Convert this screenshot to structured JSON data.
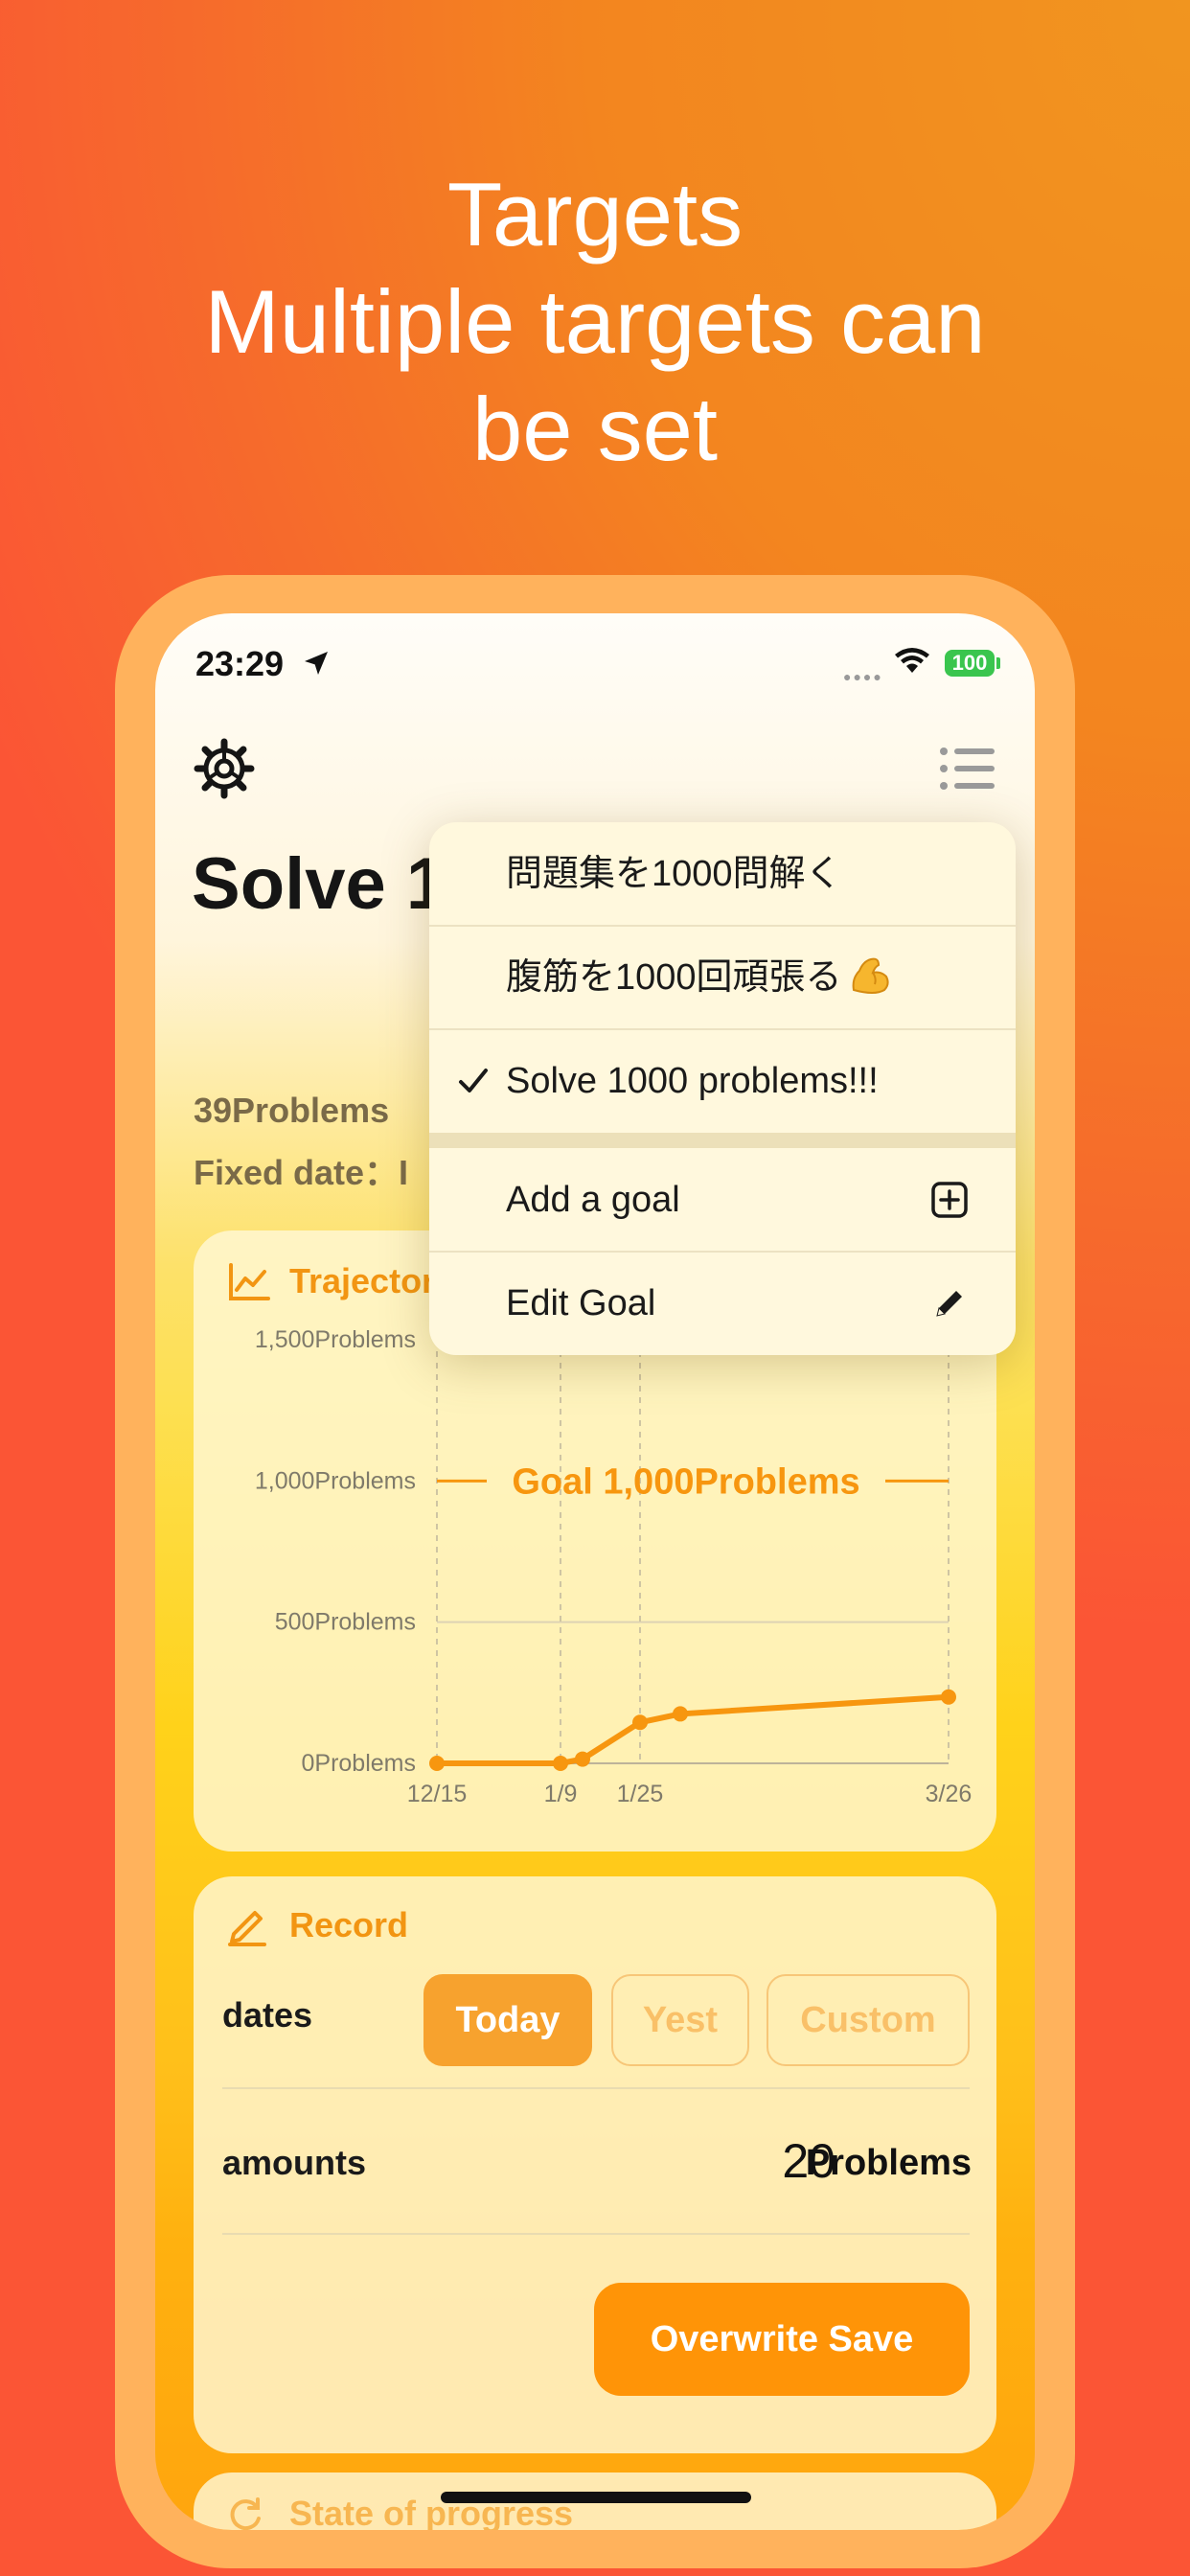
{
  "headline": {
    "line1": "Targets",
    "line2": "Multiple targets can",
    "line3": "be set"
  },
  "status_bar": {
    "time": "23:29",
    "battery": "100"
  },
  "goal": {
    "title": "Solve 1000 problems!!!",
    "progress_text": "39Problems",
    "fixed_date_text": "Fixed date：I"
  },
  "chart_card": {
    "label": "Trajectory"
  },
  "chart_data": {
    "type": "line",
    "x": [
      "12/15",
      "1/9",
      "1/14",
      "1/25",
      "2/3",
      "3/26"
    ],
    "values": [
      0,
      0,
      15,
      145,
      175,
      235
    ],
    "ylim": [
      0,
      1500
    ],
    "y_ticks": [
      "0Problems",
      "500Problems",
      "1,000Problems",
      "1,500Problems"
    ],
    "x_ticks": [
      "12/15",
      "1/9",
      "1/25",
      "3/26"
    ],
    "goal_line": {
      "value": 1000,
      "label": "Goal 1,000Problems"
    },
    "color": "#f7960f",
    "grid": true
  },
  "record_card": {
    "label": "Record",
    "dates_label": "dates",
    "segments": [
      "Today",
      "Yest",
      "Custom"
    ],
    "selected_segment": "Today",
    "amounts_label": "amounts",
    "amount_value": "20",
    "amount_unit": "Problems",
    "save_button": "Overwrite Save"
  },
  "progress_card": {
    "label": "State of progress"
  },
  "menu": {
    "items": [
      {
        "label": "問題集を1000問解く",
        "checked": false
      },
      {
        "label": "腹筋を1000回頑張る",
        "checked": false
      },
      {
        "label": "Solve 1000 problems!!!",
        "checked": true
      }
    ],
    "actions": [
      {
        "label": "Add a goal",
        "icon": "plus-square-icon"
      },
      {
        "label": "Edit Goal",
        "icon": "pencil-icon"
      }
    ]
  },
  "colors": {
    "accent": "#f7960f",
    "button": "#ff9407",
    "segment_selected": "#f7a22e",
    "label_orange": "#f29512",
    "battery": "#3ac54e"
  }
}
